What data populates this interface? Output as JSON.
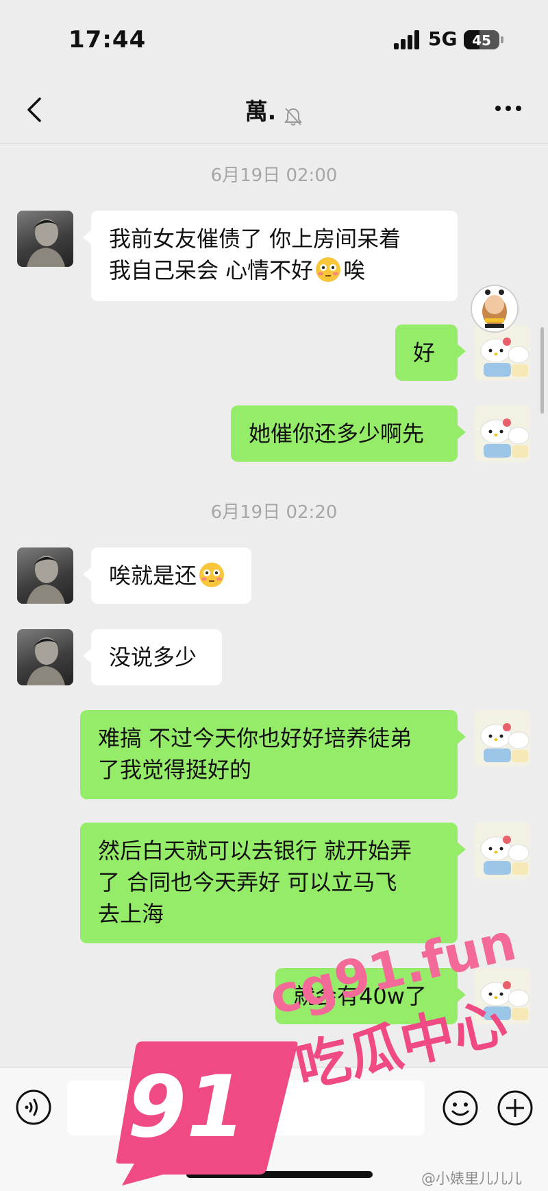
{
  "status_bar": {
    "time": "17:44",
    "network": "5G",
    "battery": "45"
  },
  "header": {
    "title": "萬."
  },
  "messages": [
    {
      "type": "timestamp",
      "text": "6月19日 02:00"
    },
    {
      "type": "in",
      "lines": [
        "我前女友催债了  你上房间呆着",
        "我自己呆会 心情不好"
      ],
      "tail": "唉"
    },
    {
      "type": "out",
      "text": "好"
    },
    {
      "type": "out",
      "text": "她催你还多少啊先"
    },
    {
      "type": "timestamp",
      "text": "6月19日 02:20"
    },
    {
      "type": "in",
      "text": "唉就是还"
    },
    {
      "type": "in",
      "text": "没说多少"
    },
    {
      "type": "out",
      "lines": [
        "难搞 不过今天你也好好培养徒弟",
        "了我觉得挺好的"
      ]
    },
    {
      "type": "out",
      "lines": [
        "然后白天就可以去银行 就开始弄",
        "了 合同也今天弄好 可以立马飞",
        "去上海"
      ]
    },
    {
      "type": "out",
      "text": "就会有40w了"
    }
  ],
  "watermark": {
    "badge": "91",
    "url": "cg91.fun",
    "name": "吃瓜中心",
    "weibo": "@小婊里儿儿儿"
  },
  "colors": {
    "background": "#ededed",
    "out_bubble": "#95ec69",
    "in_bubble": "#ffffff",
    "watermark": "#ef4a84"
  },
  "icons": [
    "back-arrow-icon",
    "mute-bell-icon",
    "more-icon",
    "voice-icon",
    "emoji-icon",
    "plus-icon",
    "flushed-face-emoji"
  ]
}
